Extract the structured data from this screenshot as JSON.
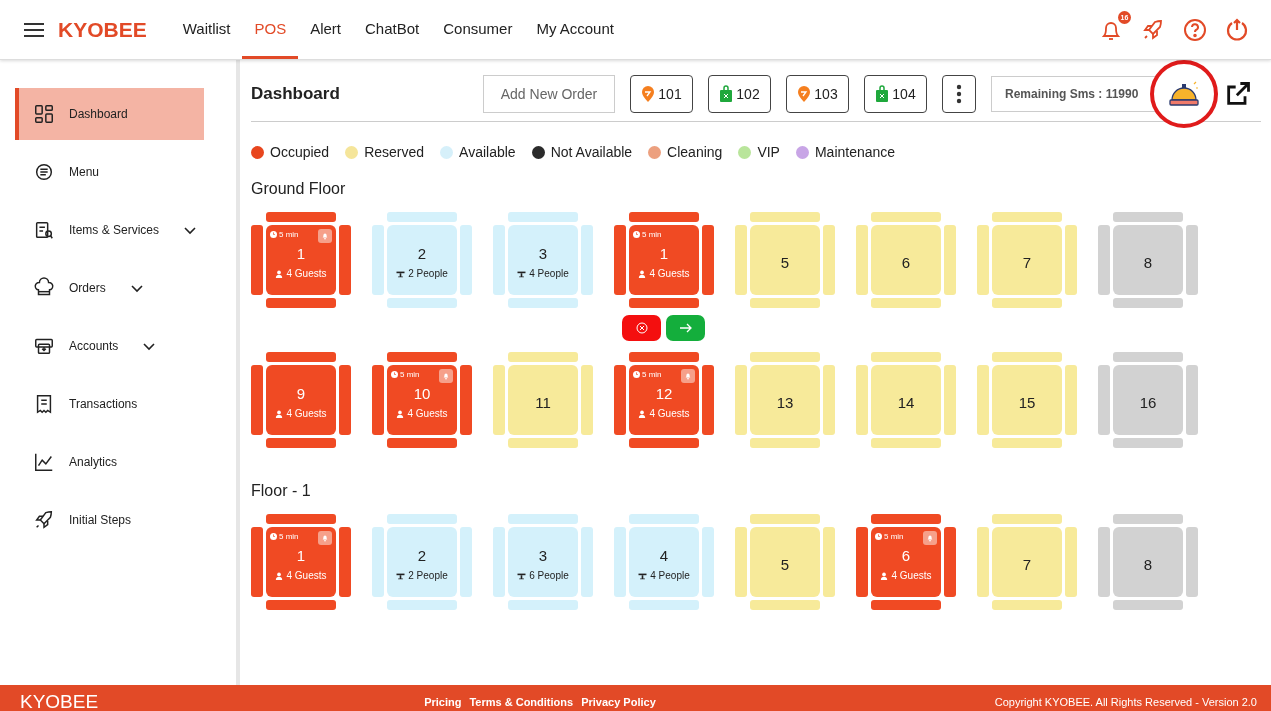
{
  "header": {
    "logo": "KYOBEE",
    "nav": [
      {
        "label": "Waitlist",
        "selected": false
      },
      {
        "label": "POS",
        "selected": true
      },
      {
        "label": "Alert",
        "selected": false
      },
      {
        "label": "ChatBot",
        "selected": false
      },
      {
        "label": "Consumer",
        "selected": false
      },
      {
        "label": "My Account",
        "selected": false
      }
    ],
    "notification_count": "16"
  },
  "sidebar": {
    "items": [
      {
        "label": "Dashboard",
        "selected": true,
        "expandable": false
      },
      {
        "label": "Menu",
        "selected": false,
        "expandable": false
      },
      {
        "label": "Items & Services",
        "selected": false,
        "expandable": true
      },
      {
        "label": "Orders",
        "selected": false,
        "expandable": true
      },
      {
        "label": "Accounts",
        "selected": false,
        "expandable": true
      },
      {
        "label": "Transactions",
        "selected": false,
        "expandable": false
      },
      {
        "label": "Analytics",
        "selected": false,
        "expandable": false
      },
      {
        "label": "Initial Steps",
        "selected": false,
        "expandable": false
      }
    ]
  },
  "toolbar": {
    "title": "Dashboard",
    "add_button": "Add New Order",
    "orders": [
      {
        "kind": "drop",
        "number": "101"
      },
      {
        "kind": "bag",
        "number": "102"
      },
      {
        "kind": "drop",
        "number": "103"
      },
      {
        "kind": "bag",
        "number": "104"
      }
    ],
    "sms": "Remaining Sms : 11990"
  },
  "legend": [
    {
      "label": "Occupied",
      "color": "#e8461e"
    },
    {
      "label": "Reserved",
      "color": "#f5e59a"
    },
    {
      "label": "Available",
      "color": "#d6f0fa"
    },
    {
      "label": "Not Available",
      "color": "#2b2b2b"
    },
    {
      "label": "Cleaning",
      "color": "#eca07f"
    },
    {
      "label": "VIP",
      "color": "#b9e59b"
    },
    {
      "label": "Maintenance",
      "color": "#c8a5e6"
    }
  ],
  "floors": [
    {
      "name": "Ground Floor",
      "tables": [
        {
          "number": "1",
          "kind": "occupied",
          "timer": "5 min",
          "bell": true,
          "info": "4 Guests",
          "actions": false
        },
        {
          "number": "2",
          "kind": "available",
          "info": "2 People",
          "bell": false,
          "actions": false
        },
        {
          "number": "3",
          "kind": "available",
          "info": "4 People",
          "bell": false,
          "actions": false
        },
        {
          "number": "1",
          "kind": "occupied",
          "timer": "5 min",
          "bell": false,
          "info": "4 Guests",
          "actions": true
        },
        {
          "number": "5",
          "kind": "reserved",
          "bell": false,
          "actions": false
        },
        {
          "number": "6",
          "kind": "reserved",
          "bell": false,
          "actions": false
        },
        {
          "number": "7",
          "kind": "reserved",
          "bell": false,
          "actions": false
        },
        {
          "number": "8",
          "kind": "unavailable",
          "bell": false,
          "actions": false
        },
        {
          "number": "9",
          "kind": "occupied",
          "bell": false,
          "info": "4 Guests",
          "actions": false
        },
        {
          "number": "10",
          "kind": "occupied",
          "timer": "5 min",
          "bell": true,
          "info": "4 Guests",
          "actions": false
        },
        {
          "number": "11",
          "kind": "reserved",
          "bell": false,
          "actions": false
        },
        {
          "number": "12",
          "kind": "occupied",
          "timer": "5 min",
          "bell": true,
          "info": "4 Guests",
          "actions": false
        },
        {
          "number": "13",
          "kind": "reserved",
          "bell": false,
          "actions": false
        },
        {
          "number": "14",
          "kind": "reserved",
          "bell": false,
          "actions": false
        },
        {
          "number": "15",
          "kind": "reserved",
          "bell": false,
          "actions": false
        },
        {
          "number": "16",
          "kind": "unavailable",
          "bell": false,
          "actions": false
        }
      ]
    },
    {
      "name": "Floor - 1",
      "tables": [
        {
          "number": "1",
          "kind": "occupied",
          "timer": "5 min",
          "bell": true,
          "info": "4 Guests",
          "actions": false
        },
        {
          "number": "2",
          "kind": "available",
          "info": "2 People",
          "bell": false,
          "actions": false
        },
        {
          "number": "3",
          "kind": "available",
          "info": "6 People",
          "bell": false,
          "actions": false
        },
        {
          "number": "4",
          "kind": "available",
          "info": "4 People",
          "bell": false,
          "actions": false
        },
        {
          "number": "5",
          "kind": "reserved",
          "bell": false,
          "actions": false
        },
        {
          "number": "6",
          "kind": "occupied",
          "timer": "5 min",
          "bell": true,
          "info": "4 Guests",
          "actions": false
        },
        {
          "number": "7",
          "kind": "reserved",
          "bell": false,
          "actions": false
        },
        {
          "number": "8",
          "kind": "unavailable",
          "bell": false,
          "actions": false
        }
      ]
    }
  ],
  "footer": {
    "logo": "KYOBEE",
    "links": [
      "Pricing",
      "Terms & Conditions",
      "Privacy Policy"
    ],
    "copyright": "Copyright KYOBEE. All Rights Reserved - Version 2.0"
  }
}
